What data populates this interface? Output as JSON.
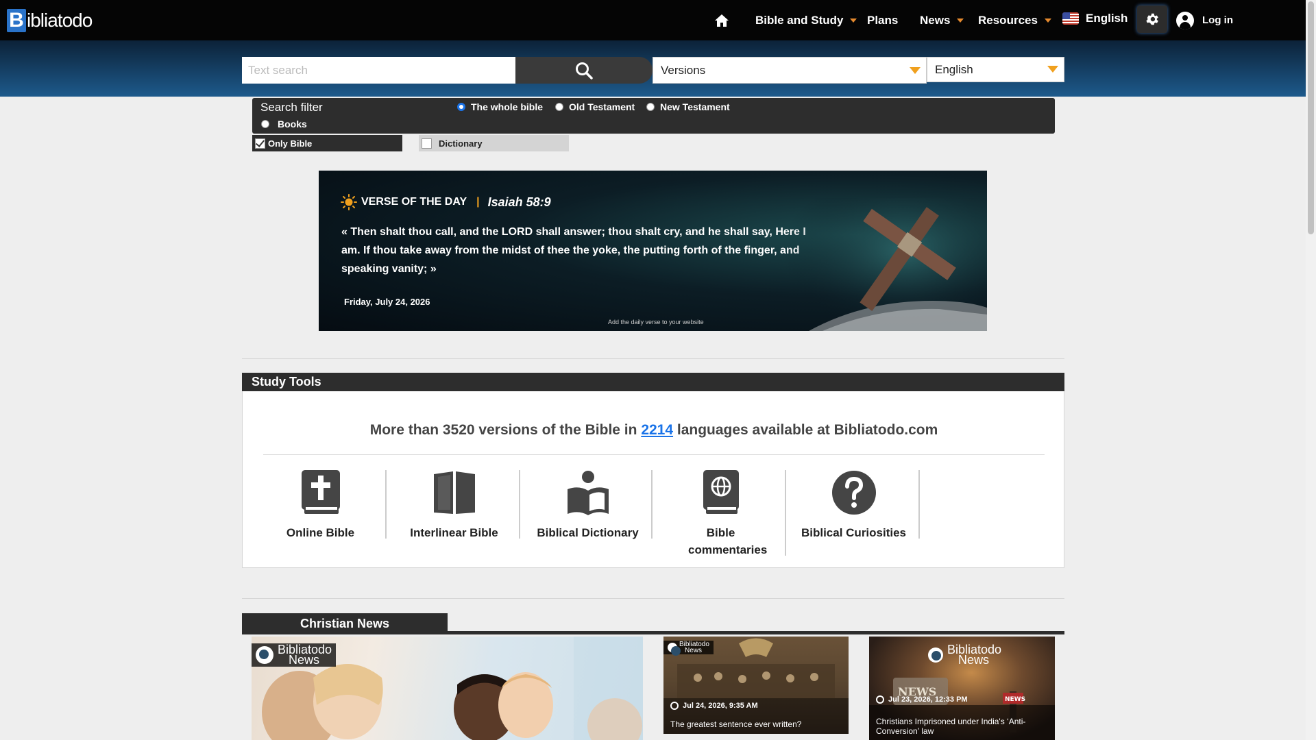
{
  "header": {
    "logo_letter": "B",
    "logo_rest": "ibliatodo",
    "nav": {
      "bible_study": "Bible and Study",
      "plans": "Plans",
      "news": "News",
      "resources": "Resources",
      "language": "English",
      "login": "Log in"
    }
  },
  "search": {
    "placeholder": "Text search",
    "versions_label": "Versions",
    "language_label": "English"
  },
  "filter": {
    "title": "Search filter",
    "options": [
      "The whole bible",
      "Old Testament",
      "New Testament",
      "Books"
    ],
    "selected": "The whole bible",
    "only_bible": "Only Bible",
    "dictionary": "Dictionary"
  },
  "votd": {
    "label": "VERSE OF THE DAY",
    "separator": "|",
    "reference": "Isaiah 58:9",
    "text": "« Then shalt thou call, and the LORD shall answer; thou shalt cry, and he shall say, Here I am. If thou take away from the midst of thee the yoke, the putting forth of the finger, and speaking vanity; »",
    "date": "Friday, July 24, 2026",
    "add_link": "Add the daily verse to your website"
  },
  "study_tools": {
    "title": "Study Tools",
    "headline_pre": "More than 3520 versions of the Bible in ",
    "headline_link": "2214",
    "headline_post": " languages available at Bibliatodo.com",
    "tools": [
      "Online Bible",
      "Interlinear Bible",
      "Biblical Dictionary",
      "Bible commentaries",
      "Biblical Curiosities"
    ]
  },
  "news": {
    "title": "Christian News",
    "brand_line1": "Bibliatodo",
    "brand_line2": "News",
    "items": [
      {
        "date": "",
        "title": ""
      },
      {
        "date": "Jul 24, 2026, 9:35 AM",
        "title": "The greatest sentence ever written?"
      },
      {
        "date": "Jul 23, 2026, 12:33 PM",
        "title": "Christians Imprisoned under India's ‘Anti-Conversion’ law"
      }
    ]
  },
  "colors": {
    "accent_orange": "#e68a2e",
    "link_blue": "#1a73e8",
    "dark_bar": "#2d2d2d"
  }
}
